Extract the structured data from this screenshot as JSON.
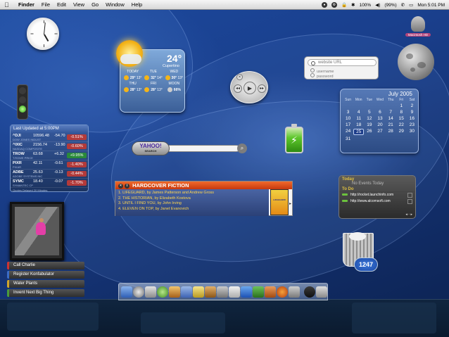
{
  "menubar": {
    "apple": "",
    "items": [
      "Finder",
      "File",
      "Edit",
      "View",
      "Go",
      "Window",
      "Help"
    ],
    "battery": "100%",
    "wifi_pct": "(99%)",
    "clock": "Mon 5:01 PM"
  },
  "stocks": {
    "header": "Last Updated at 5:00PM",
    "rows": [
      {
        "sym": "^DJI",
        "sub": "DOW JONES INDUST",
        "price": "10596.48",
        "change": "-54.70",
        "pct": "-0.51%"
      },
      {
        "sym": "^IXIC",
        "sub": "NASDAQ COMPOSITE",
        "price": "2156.74",
        "change": "-13.90",
        "pct": "-0.60%"
      },
      {
        "sym": "TROW",
        "sub": "T.ROWE PRICE",
        "price": "63.68",
        "change": "+6.32",
        "pct": "+9.95%"
      },
      {
        "sym": "PIXR",
        "sub": "PIXAR",
        "price": "42.11",
        "change": "-0.61",
        "pct": "-1.40%"
      },
      {
        "sym": "ADBE",
        "sub": "ADOBE SYSTEMS INC",
        "price": "25.63",
        "change": "-0.13",
        "pct": "-0.44%"
      },
      {
        "sym": "SYMC",
        "sub": "SYMANTEC CP",
        "price": "18.40",
        "change": "-0.07",
        "pct": "-1.70%"
      }
    ],
    "footer": "Quotes Delayed 20 Minutes"
  },
  "weather": {
    "temp": "24°",
    "city": "Cupertino",
    "days": [
      {
        "name": "TODAY",
        "hi": "29°",
        "lo": "13°"
      },
      {
        "name": "TUE",
        "hi": "32°",
        "lo": "14°"
      },
      {
        "name": "WED",
        "hi": "30°",
        "lo": "13°"
      },
      {
        "name": "THU",
        "hi": "28°",
        "lo": "13°"
      },
      {
        "name": "FRI",
        "hi": "28°",
        "lo": "13°"
      },
      {
        "name": "MOON",
        "hi": "66%",
        "lo": ""
      }
    ]
  },
  "yahoo": {
    "logo": "YAHOO!",
    "logo_sub": "SEARCH",
    "go": "⌕"
  },
  "books": {
    "title": "HARDCOVER FICTION",
    "items": [
      "1. LIFEGUARD, by James Patterson and Andrew Gross",
      "2. THE HISTORIAN, by Elizabeth Kostova",
      "3. UNTIL I FIND YOU, by John Irving",
      "4. ELEVEN ON TOP, by Janet Evanovich"
    ],
    "cover_text": "LIFEGUARD"
  },
  "dictionary": {
    "label": "Macintosh HD"
  },
  "url_widget": {
    "placeholder": "website URL",
    "opt1": "username",
    "opt2": "password"
  },
  "calendar": {
    "month": "July 2005",
    "headers": [
      "Sun",
      "Mon",
      "Tue",
      "Wed",
      "Thu",
      "Fri",
      "Sat"
    ],
    "weeks": [
      [
        "",
        "",
        "",
        "",
        "",
        "1",
        "2"
      ],
      [
        "3",
        "4",
        "5",
        "6",
        "7",
        "8",
        "9"
      ],
      [
        "10",
        "11",
        "12",
        "13",
        "14",
        "15",
        "16"
      ],
      [
        "17",
        "18",
        "19",
        "20",
        "21",
        "22",
        "23"
      ],
      [
        "24",
        "25",
        "26",
        "27",
        "28",
        "29",
        "30"
      ],
      [
        "31",
        "",
        "",
        "",
        "",
        "",
        ""
      ]
    ],
    "today": "25"
  },
  "ical": {
    "today_label": "Today",
    "no_events": "No Events Today",
    "todo_label": "To Do",
    "tasks": [
      "http://rocket.launchinfo.com",
      "http://www.alcomsoft.com"
    ],
    "nav": "◂  ◦  ▸"
  },
  "trash": {
    "count": "1247"
  },
  "stickies": [
    "Call Charlie",
    "Register Konfabulator",
    "Water Plants",
    "Invent Next Big Thing"
  ],
  "player": {
    "prev": "◂◂",
    "play": "▶",
    "next": "▸▸",
    "close": "×"
  },
  "colors": {
    "accent": "#f06a2c",
    "desktop": "#1a3f8c",
    "positive": "#2a8a3a",
    "negative": "#b23a3a"
  }
}
